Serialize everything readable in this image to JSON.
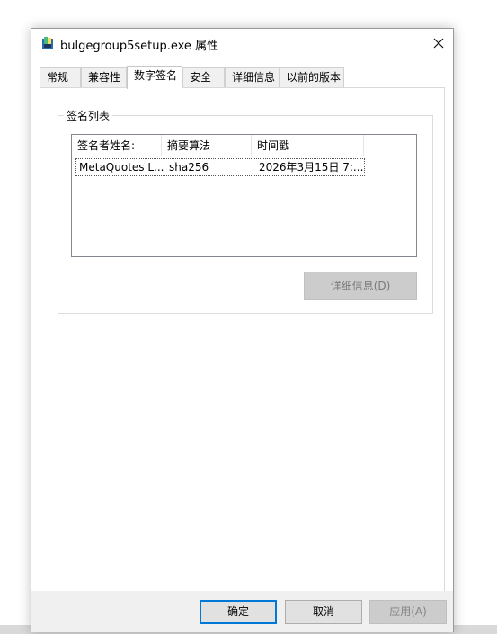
{
  "window": {
    "title": "bulgegroup5setup.exe 属性"
  },
  "tabs": [
    {
      "label": "常规",
      "active": false
    },
    {
      "label": "兼容性",
      "active": false
    },
    {
      "label": "数字签名",
      "active": true
    },
    {
      "label": "安全",
      "active": false
    },
    {
      "label": "详细信息",
      "active": false
    },
    {
      "label": "以前的版本",
      "active": false
    }
  ],
  "signature_list": {
    "title": "签名列表",
    "columns": [
      "签名者姓名:",
      "摘要算法",
      "时间戳"
    ],
    "rows": [
      [
        "MetaQuotes L...",
        "sha256",
        "2026年3月15日 7:..."
      ]
    ],
    "details_label": "详细信息(D)"
  },
  "footer": {
    "ok_label": "确定",
    "cancel_label": "取消",
    "apply_label": "应用(A)"
  },
  "colors": {
    "focus_border": "#0078d7",
    "disabled_button": "#cccccc"
  }
}
